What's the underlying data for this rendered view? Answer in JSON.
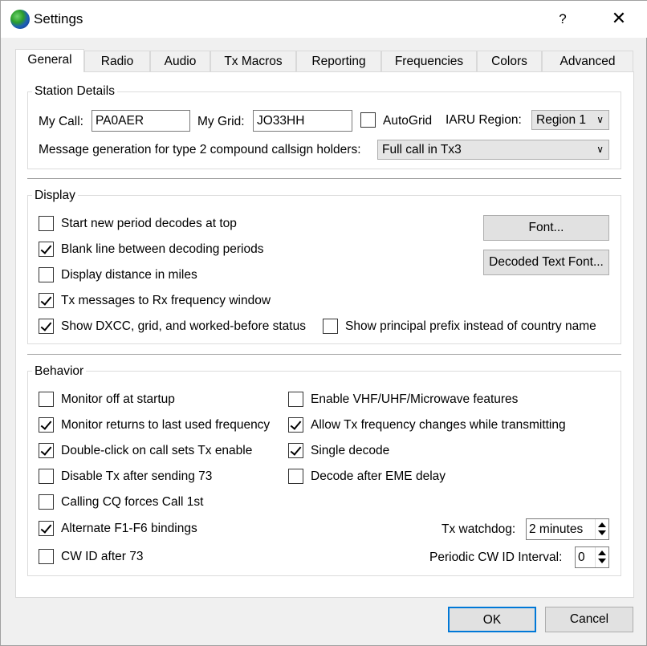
{
  "window": {
    "title": "Settings",
    "help": "?",
    "close": "✕"
  },
  "tabs": [
    "General",
    "Radio",
    "Audio",
    "Tx Macros",
    "Reporting",
    "Frequencies",
    "Colors",
    "Advanced"
  ],
  "station": {
    "title": "Station Details",
    "my_call_label": "My Call:",
    "my_call": "PA0AER",
    "my_grid_label": "My Grid:",
    "my_grid": "JO33HH",
    "autogrid_label": "AutoGrid",
    "autogrid_checked": false,
    "iaru_label": "IARU Region:",
    "iaru_value": "Region 1",
    "msg_gen_label": "Message generation for type 2 compound callsign holders:",
    "msg_gen_value": "Full call in Tx3"
  },
  "display": {
    "title": "Display",
    "items": [
      {
        "label": "Start new period decodes at top",
        "checked": false
      },
      {
        "label": "Blank line between decoding periods",
        "checked": true
      },
      {
        "label": "Display distance in miles",
        "checked": false
      },
      {
        "label": "Tx messages to Rx frequency window",
        "checked": true
      },
      {
        "label": "Show DXCC, grid, and worked-before status",
        "checked": true
      },
      {
        "label": "Show principal prefix instead of country name",
        "checked": false
      }
    ],
    "font_button": "Font...",
    "decoded_font_button": "Decoded Text Font..."
  },
  "behavior": {
    "title": "Behavior",
    "left": [
      {
        "label": "Monitor off at startup",
        "checked": false
      },
      {
        "label": "Monitor returns to last used frequency",
        "checked": true
      },
      {
        "label": "Double-click on call sets Tx enable",
        "checked": true
      },
      {
        "label": "Disable Tx after sending 73",
        "checked": false
      },
      {
        "label": "Calling CQ forces Call 1st",
        "checked": false
      },
      {
        "label": "Alternate F1-F6 bindings",
        "checked": true
      },
      {
        "label": "CW ID after 73",
        "checked": false
      }
    ],
    "right": [
      {
        "label": "Enable VHF/UHF/Microwave features",
        "checked": false
      },
      {
        "label": "Allow Tx frequency changes while transmitting",
        "checked": true
      },
      {
        "label": "Single decode",
        "checked": true
      },
      {
        "label": "Decode after EME delay",
        "checked": false
      }
    ],
    "tx_watchdog_label": "Tx watchdog:",
    "tx_watchdog_value": "2 minutes",
    "cw_interval_label": "Periodic CW ID Interval:",
    "cw_interval_value": "0"
  },
  "footer": {
    "ok": "OK",
    "cancel": "Cancel"
  }
}
